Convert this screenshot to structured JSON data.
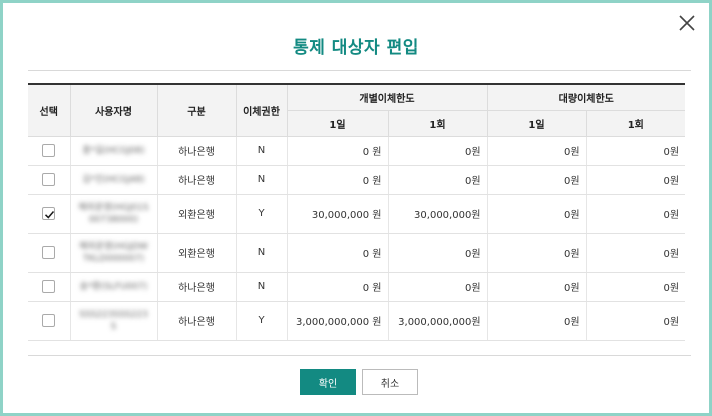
{
  "dialog": {
    "title": "통제 대상자 편입",
    "confirm_label": "확인",
    "cancel_label": "취소",
    "accent_color": "#138a82"
  },
  "table": {
    "headers": {
      "select": "선택",
      "user_name": "사용자명",
      "category": "구분",
      "transfer_auth": "이체권한",
      "individual_limit": "개별이체한도",
      "bulk_limit": "대량이체한도",
      "daily": "1일",
      "per_transfer": "1회"
    },
    "rows": [
      {
        "checked": false,
        "user": "홍*길(HCGJ08)",
        "category": "하나은행",
        "auth": "N",
        "ind_daily": "0 원",
        "ind_once": "0원",
        "bulk_daily": "0원",
        "bulk_once": "0원"
      },
      {
        "checked": false,
        "user": "김*진(HCGJ48)",
        "category": "하나은행",
        "auth": "N",
        "ind_daily": "0 원",
        "ind_once": "0원",
        "bulk_daily": "0원",
        "bulk_once": "0원"
      },
      {
        "checked": true,
        "user": "해외운영(HGJ01S00738000)",
        "category": "외환은행",
        "auth": "Y",
        "ind_daily": "30,000,000 원",
        "ind_once": "30,000,000원",
        "bulk_daily": "0원",
        "bulk_once": "0원"
      },
      {
        "checked": false,
        "user": "해외운영(HGJDWTKLD000007)",
        "category": "외환은행",
        "auth": "N",
        "ind_daily": "0 원",
        "ind_once": "0원",
        "bulk_daily": "0원",
        "bulk_once": "0원"
      },
      {
        "checked": false,
        "user": "송*환(SLFU007)",
        "category": "하나은행",
        "auth": "N",
        "ind_daily": "0 원",
        "ind_once": "0원",
        "bulk_daily": "0원",
        "bulk_once": "0원"
      },
      {
        "checked": false,
        "user": "SSS223SSS223S",
        "category": "하나은행",
        "auth": "Y",
        "ind_daily": "3,000,000,000 원",
        "ind_once": "3,000,000,000원",
        "bulk_daily": "0원",
        "bulk_once": "0원"
      }
    ]
  }
}
